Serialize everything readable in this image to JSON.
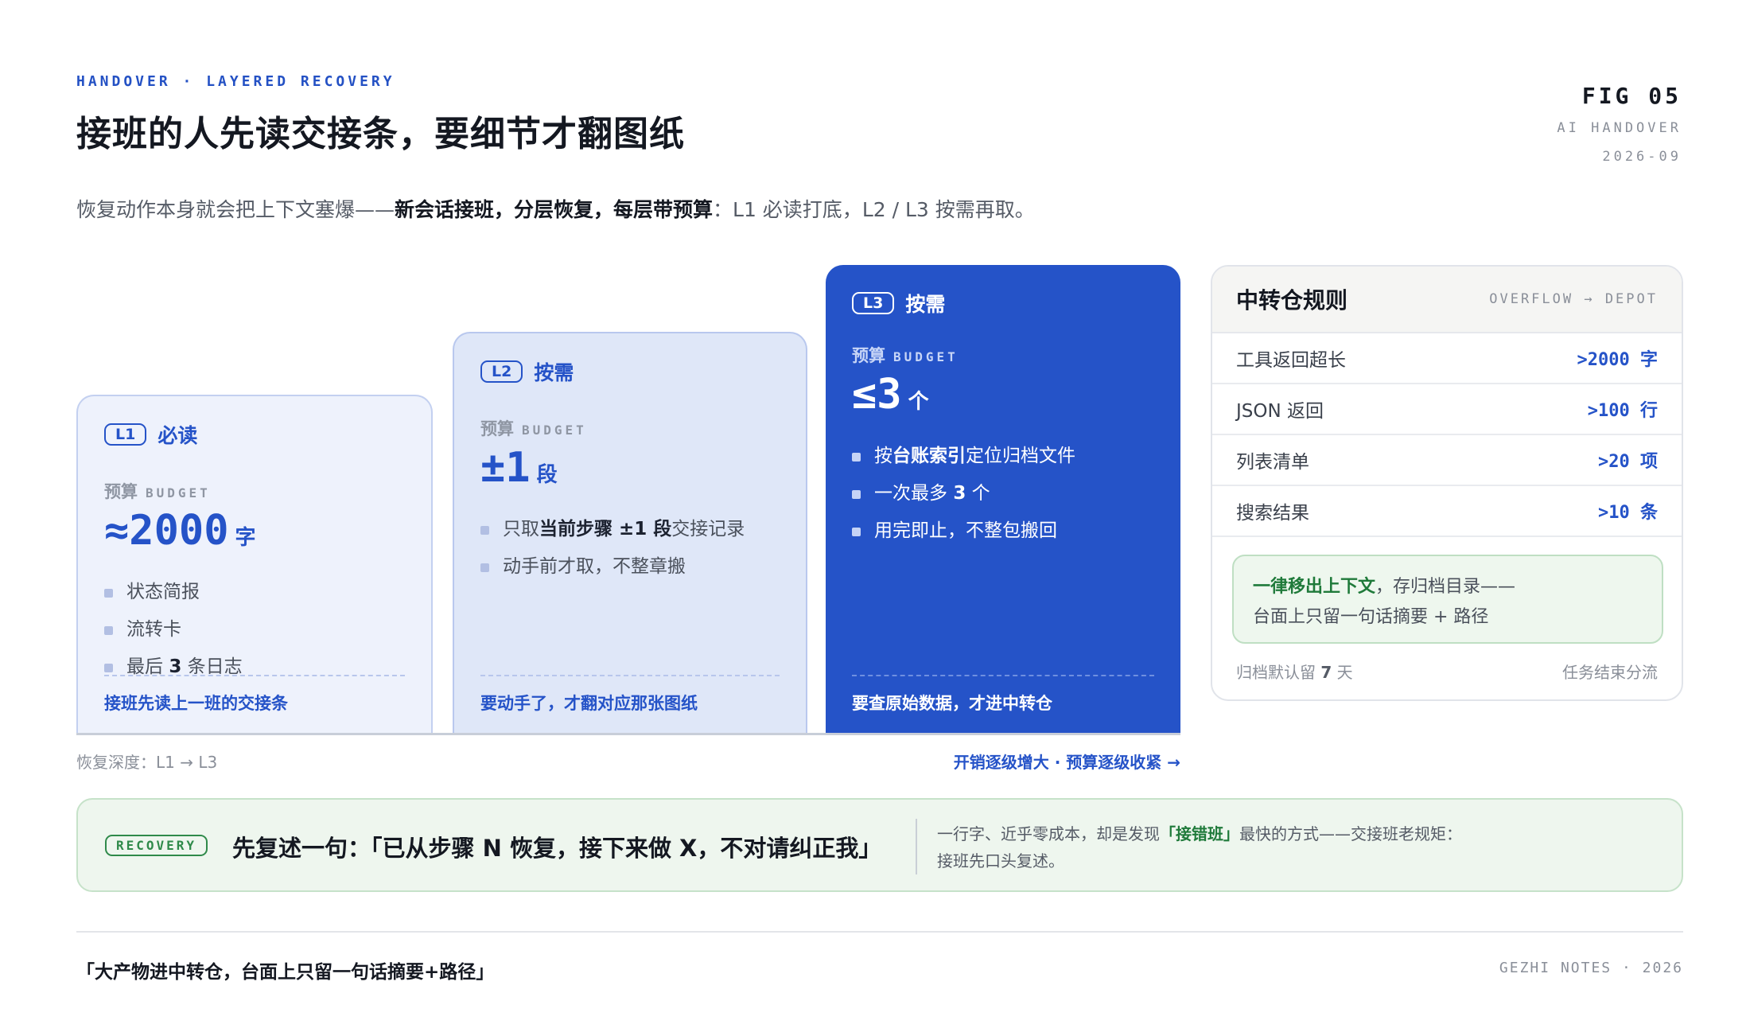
{
  "header": {
    "eyebrow": "HANDOVER · LAYERED RECOVERY",
    "title": "接班的人先读交接条，要细节才翻图纸",
    "fig_no": "FIG 05",
    "fig_sub": "AI HANDOVER",
    "fig_date": "2026-09",
    "subtitle_pre": "恢复动作本身就会把上下文塞爆——",
    "subtitle_bold": "新会话接班，分层恢复，每层带预算",
    "subtitle_post": "：L1 必读打底，L2 / L3 按需再取。"
  },
  "cards": [
    {
      "level": "L1",
      "title": "必读",
      "budget_label": "预算",
      "budget_en": "BUDGET",
      "budget_value": "≈2000",
      "budget_unit": "字",
      "items": [
        {
          "pre": "状态简报",
          "bold": "",
          "post": ""
        },
        {
          "pre": "流转卡",
          "bold": "",
          "post": ""
        },
        {
          "pre": "最后 ",
          "bold": "3",
          "post": " 条日志"
        }
      ],
      "footer": "接班先读上一班的交接条"
    },
    {
      "level": "L2",
      "title": "按需",
      "budget_label": "预算",
      "budget_en": "BUDGET",
      "budget_value": "±1",
      "budget_unit": "段",
      "items": [
        {
          "pre": "只取",
          "bold": "当前步骤 ±1 段",
          "post": "交接记录"
        },
        {
          "pre": "动手前才取，不整章搬",
          "bold": "",
          "post": ""
        }
      ],
      "footer": "要动手了，才翻对应那张图纸"
    },
    {
      "level": "L3",
      "title": "按需",
      "budget_label": "预算",
      "budget_en": "BUDGET",
      "budget_value": "≤3",
      "budget_unit": "个",
      "items": [
        {
          "pre": "按",
          "bold": "台账索引",
          "post": "定位归档文件"
        },
        {
          "pre": "一次最多 ",
          "bold": "3",
          "post": " 个"
        },
        {
          "pre": "用完即止，不整包搬回",
          "bold": "",
          "post": ""
        }
      ],
      "footer": "要查原始数据，才进中转仓"
    }
  ],
  "axis": {
    "depth": "恢复深度：L1 → L3",
    "trend": "开销逐级增大 · 预算逐级收紧 →"
  },
  "depot": {
    "title": "中转仓规则",
    "subtitle": "OVERFLOW → DEPOT",
    "rows": [
      {
        "key": "工具返回超长",
        "value": ">2000 字"
      },
      {
        "key": "JSON 返回",
        "value": ">100 行"
      },
      {
        "key": "列表清单",
        "value": ">20 项"
      },
      {
        "key": "搜索结果",
        "value": ">10 条"
      }
    ],
    "note_bold": "一律移出上下文",
    "note_line1": "，存归档目录——",
    "note_line2": "台面上只留一句话摘要 + 路径",
    "foot_left_pre": "归档默认留 ",
    "foot_left_bold": "7",
    "foot_left_post": " 天",
    "foot_right": "任务结束分流"
  },
  "recovery": {
    "tag": "RECOVERY",
    "quote": "先复述一句：「已从步骤 N 恢复，接下来做 X，不对请纠正我」",
    "text_pre": "一行字、近乎零成本，却是发现",
    "text_bold": "「接错班」",
    "text_post": "最快的方式——交接班老规矩：",
    "text_line2": "接班先口头复述。"
  },
  "footer": {
    "quote": "「大产物进中转仓，台面上只留一句话摘要+路径」",
    "note": "GEZHI NOTES · 2026"
  },
  "colors": {
    "accent": "#2553c8",
    "green": "#2f8a4a",
    "text": "#141821"
  }
}
